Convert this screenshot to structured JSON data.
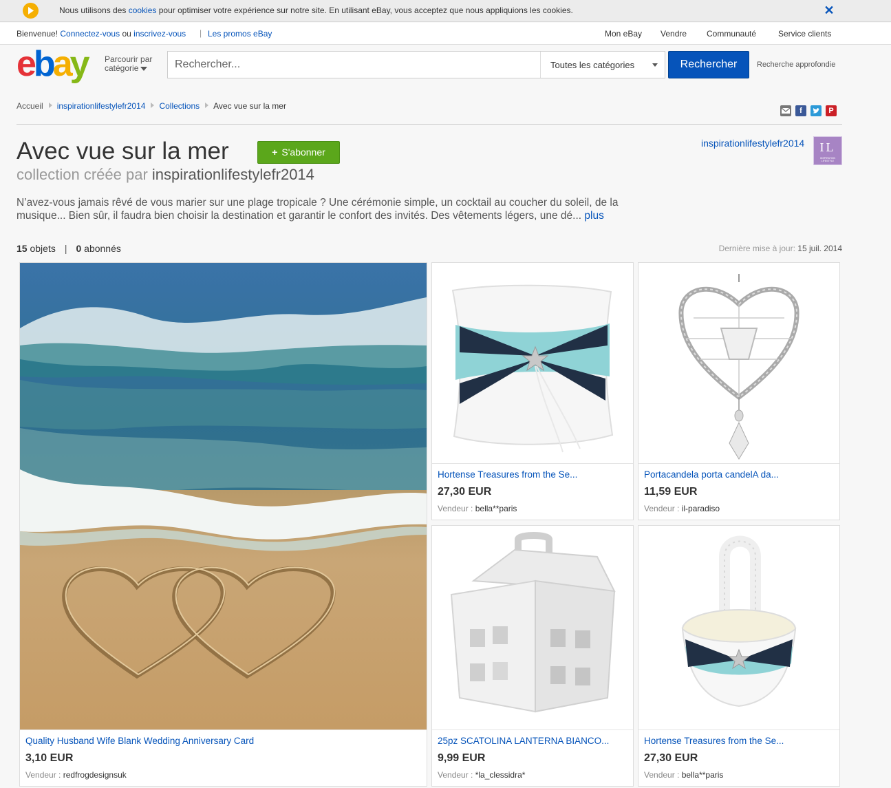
{
  "cookie_bar": {
    "text_before": "Nous utilisons des ",
    "link": "cookies",
    "text_after": " pour optimiser votre expérience sur notre site. En utilisant eBay, vous acceptez que nous appliquions les cookies.",
    "close": "✕"
  },
  "topnav": {
    "welcome": "Bienvenue!",
    "sign_in": "Connectez-vous",
    "or": "ou",
    "register": "inscrivez-vous",
    "promos": "Les promos eBay",
    "my_ebay": "Mon eBay",
    "sell": "Vendre",
    "community": "Communauté",
    "help": "Service clients"
  },
  "header": {
    "logo": [
      "e",
      "b",
      "a",
      "y"
    ],
    "browse_line1": "Parcourir par",
    "browse_line2": "catégorie",
    "search_placeholder": "Rechercher...",
    "category": "Toutes les catégories",
    "search_button": "Rechercher",
    "advanced": "Recherche approfondie"
  },
  "breadcrumb": [
    "Accueil",
    "inspirationlifestylefr2014",
    "Collections",
    "Avec vue sur la mer"
  ],
  "collection": {
    "title": "Avec vue sur la mer",
    "follow": "S'abonner",
    "created_by": "collection créée par ",
    "owner": "inspirationlifestylefr2014",
    "avatar_letters": "IL",
    "avatar_caption": "INSPIRATION LIFESTYLE",
    "description": "N’avez-vous jamais rêvé de vous marier sur une plage tropicale ? Une cérémonie simple, un cocktail au coucher du soleil, de la musique... Bien sûr, il faudra bien choisir la destination et garantir le confort des invités. Des vêtements légers, une dé...",
    "more": "plus",
    "item_count": "15",
    "items_label": "objets",
    "follower_count": "0",
    "followers_label": "abonnés",
    "updated_label": "Dernière mise à jour:",
    "updated_date": "15 juil. 2014"
  },
  "seller_label": "Vendeur :",
  "items": [
    {
      "title": "Quality Husband Wife Blank Wedding Anniversary Card",
      "price": "3,10 EUR",
      "seller": "redfrogdesignsuk"
    },
    {
      "title": "Hortense Treasures from the Se...",
      "price": "27,30 EUR",
      "seller": "bella**paris"
    },
    {
      "title": "Portacandela porta candelA da...",
      "price": "11,59 EUR",
      "seller": "il-paradiso"
    },
    {
      "title": "25pz SCATOLINA LANTERNA BIANCO...",
      "price": "9,99 EUR",
      "seller": "*la_clessidra*"
    },
    {
      "title": "Hortense Treasures from the Se...",
      "price": "27,30 EUR",
      "seller": "bella**paris"
    }
  ],
  "colors": {
    "link": "#0654ba",
    "search_button": "#0654ba",
    "follow_button": "#5ba71b"
  }
}
